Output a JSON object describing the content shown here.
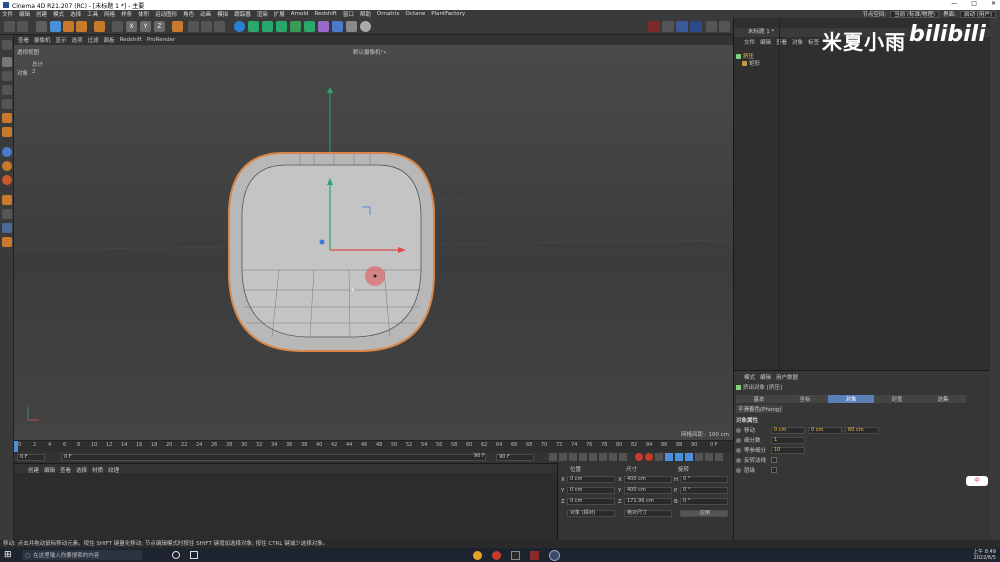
{
  "window": {
    "title": "Cinema 4D R21.207 (RC) - [未标题 1 *] - 主要"
  },
  "menubar": {
    "items": [
      "文件",
      "编辑",
      "创建",
      "模式",
      "选择",
      "工具",
      "网格",
      "样条",
      "体积",
      "运动图形",
      "角色",
      "动画",
      "模拟",
      "跟踪器",
      "渲染",
      "扩展",
      "Arnold",
      "Redshift",
      "窗口",
      "帮助",
      "Ornatrix",
      "Octane",
      "PlantFactory"
    ],
    "node_space_label": "节点空间:",
    "node_space_value": "当前 (标准/物理)",
    "layout_label": "界面:",
    "layout_value": "启动 (用户)"
  },
  "toolbar": {
    "axis_labels": [
      "X",
      "Y",
      "Z"
    ]
  },
  "viewport": {
    "menu": [
      "查看",
      "摄像机",
      "显示",
      "选项",
      "过滤",
      "面板",
      "Redshift",
      "ProRender"
    ],
    "view_name": "透视视图",
    "camera_label": "默认摄像机°•",
    "stats_title": "总计",
    "stats_label": "对象",
    "stats_value": "2",
    "grid_spacing": "网格间距 : 100 cm"
  },
  "timeline": {
    "ticks": [
      "0",
      "2",
      "4",
      "6",
      "8",
      "10",
      "12",
      "14",
      "16",
      "18",
      "20",
      "22",
      "24",
      "26",
      "28",
      "30",
      "32",
      "34",
      "36",
      "38",
      "40",
      "42",
      "44",
      "46",
      "48",
      "50",
      "52",
      "54",
      "56",
      "58",
      "60",
      "62",
      "64",
      "66",
      "68",
      "70",
      "72",
      "74",
      "76",
      "78",
      "80",
      "82",
      "84",
      "86",
      "88",
      "90"
    ],
    "end_frame": "0 F",
    "current_frame": "0 F",
    "start_field": "0 F",
    "max_field_1": "90 F",
    "max_field_2": "90 F"
  },
  "material_panel": {
    "menu": [
      "创建",
      "编辑",
      "查看",
      "选择",
      "材质",
      "纹理"
    ]
  },
  "coord_panel": {
    "headers": [
      "位置",
      "尺寸",
      "旋转"
    ],
    "rows": [
      {
        "axis": "X",
        "pos": "0 cm",
        "size_axis": "X",
        "size": "400 cm",
        "rot_axis": "H",
        "rot": "0 °"
      },
      {
        "axis": "Y",
        "pos": "0 cm",
        "size_axis": "Y",
        "size": "400 cm",
        "rot_axis": "P",
        "rot": "0 °"
      },
      {
        "axis": "Z",
        "pos": "0 cm",
        "size_axis": "Z",
        "size": "171.96 cm",
        "rot_axis": "B",
        "rot": "0 °"
      }
    ],
    "mode1": "对象 (相对)",
    "mode2": "绝对尺寸",
    "apply": "应用"
  },
  "object_panel": {
    "tab": "未标题 1 *",
    "menu": [
      "文件",
      "编辑",
      "查看",
      "对象",
      "标签",
      "书签"
    ],
    "objects": [
      {
        "name": "挤压",
        "color": "#7fd27f"
      },
      {
        "name": "矩形",
        "color": "#c89a4a"
      }
    ]
  },
  "watermark": {
    "cn": "米夏小雨",
    "brand": "bilibili"
  },
  "attr_panel": {
    "menu": [
      "模式",
      "编辑",
      "用户数据"
    ],
    "object_title": "挤出对象 [挤压]",
    "tabs": [
      "基本",
      "坐标",
      "对象",
      "封盖",
      "选集"
    ],
    "active_tab": "对象",
    "phong": "平滑着色(Phong)",
    "section": "对象属性",
    "fields": [
      {
        "label": "移动",
        "values": [
          "0 cm",
          "0 cm",
          "60 cm"
        ]
      },
      {
        "label": "细分数",
        "values": [
          "1"
        ]
      },
      {
        "label": "等参细分",
        "values": [
          "10"
        ]
      },
      {
        "label": "反转法线",
        "values": []
      },
      {
        "label": "层级",
        "values": []
      }
    ]
  },
  "statusbar": {
    "text": "移动: 点击并拖动鼠标移动元素。按住 SHIFT 键量化移动; 节点编辑模式时按住 SHIFT 键增加选择对象; 按住 CTRL 键减少选择对象。"
  },
  "taskbar": {
    "search_placeholder": "在这里输入你要搜索的内容",
    "time": "上午 8:49",
    "date": "2022/6/5"
  },
  "ime": {
    "label": "中"
  }
}
